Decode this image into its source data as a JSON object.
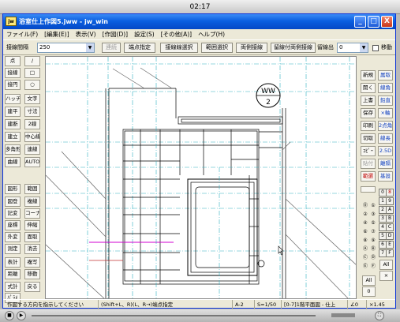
{
  "clock": "02:17",
  "window": {
    "title": "浴室仕上作図5.jww - jw_win",
    "icon": "jw",
    "min": "_",
    "max": "□",
    "close": "X"
  },
  "menu": [
    "ファイル(F)",
    "[編集(E)]",
    "表示(V)",
    "[作図(D)]",
    "設定(S)",
    "[その他(A)]",
    "ヘルプ(H)"
  ],
  "ctrl": {
    "label": "接線間隔",
    "value": "250",
    "b1": "連続",
    "b2": "端点指定",
    "b3": "接線線選択",
    "b4": "範囲選択",
    "b5": "両側接線",
    "b6": "留線付両側接線",
    "b7": "留線出",
    "value2": "0",
    "move": "移動"
  },
  "left": [
    [
      "点",
      "/"
    ],
    [
      "接線",
      "□"
    ],
    [
      "接円",
      "○"
    ],
    [
      "ハッチ",
      "文字"
    ],
    [
      "建平",
      "寸法"
    ],
    [
      "建断",
      "2線"
    ],
    [
      "建立",
      "中心線"
    ],
    [
      "多角形",
      "連線"
    ],
    [
      "曲線",
      "AUTO"
    ],
    [
      "",
      ""
    ],
    [
      "図形",
      "範囲"
    ],
    [
      "図登",
      "複線"
    ],
    [
      "記変",
      "コーナー"
    ],
    [
      "座標",
      "伸縮"
    ],
    [
      "外変",
      "面取"
    ],
    [
      "測定",
      "消去"
    ],
    [
      "表計",
      "複写"
    ],
    [
      "距離",
      "移動"
    ],
    [
      "式計",
      "戻る"
    ],
    [
      "ﾊﾟﾗﾒ",
      ""
    ]
  ],
  "right": [
    [
      "新規",
      "属取"
    ],
    [
      "開く",
      "線角"
    ],
    [
      "上書",
      "鉛直"
    ],
    [
      "保存",
      "×軸"
    ],
    [
      "印刷",
      "2点角"
    ],
    [
      "切取",
      "線長"
    ],
    [
      "ｺﾋﾟｰ",
      "2.5D"
    ],
    [
      "貼付",
      "離隔"
    ],
    [
      "範選",
      "基設"
    ]
  ],
  "layers": [
    "0",
    "8",
    "1",
    "9",
    "2",
    "A",
    "3",
    "B",
    "4",
    "C",
    "5",
    "D",
    "6",
    "E",
    "7",
    "F"
  ],
  "all": "All",
  "x_btn": "×",
  "layer_num": "0",
  "grp": [
    "⓪",
    "①",
    "②",
    "③",
    "④",
    "⑤",
    "⑥",
    "⑦",
    "⑧",
    "⑨",
    "Ⓐ",
    "Ⓑ",
    "Ⓒ",
    "Ⓓ",
    "Ⓔ",
    "Ⓕ"
  ],
  "drawing": {
    "tag_top": "WW",
    "tag_bottom": "2"
  },
  "status": {
    "hint": "作図する方向を指示してください",
    "keys": "(Shift+L、R)(L、R→)端点指定",
    "paper": "A-2",
    "scale": "S=1/50",
    "layer": "[0-7]1階平面図 - 仕上",
    "angle": "∠0",
    "zoom": "×1.45"
  }
}
